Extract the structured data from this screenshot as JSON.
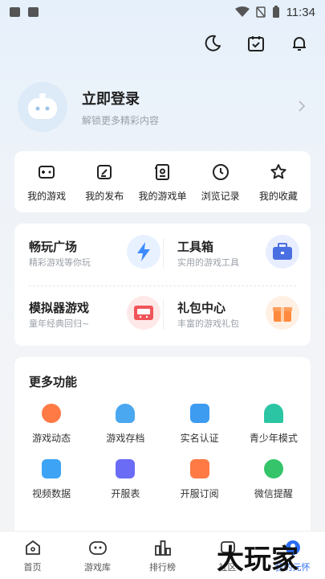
{
  "status": {
    "time": "11:34"
  },
  "profile": {
    "title": "立即登录",
    "subtitle": "解锁更多精彩内容"
  },
  "quick": [
    {
      "label": "我的游戏",
      "icon": "gamepad-icon"
    },
    {
      "label": "我的发布",
      "icon": "edit-icon"
    },
    {
      "label": "我的游戏单",
      "icon": "game-list-icon"
    },
    {
      "label": "浏览记录",
      "icon": "clock-icon"
    },
    {
      "label": "我的收藏",
      "icon": "star-icon"
    }
  ],
  "features": [
    {
      "title": "畅玩广场",
      "subtitle": "精彩游戏等你玩",
      "icon": "lightning-icon",
      "color": "#3d8bff"
    },
    {
      "title": "工具箱",
      "subtitle": "实用的游戏工具",
      "icon": "toolbox-icon",
      "color": "#4a6fe3"
    },
    {
      "title": "模拟器游戏",
      "subtitle": "童年经典回归~",
      "icon": "emulator-icon",
      "color": "#f0555a"
    },
    {
      "title": "礼包中心",
      "subtitle": "丰富的游戏礼包",
      "icon": "gift-icon",
      "color": "#ff8a3d"
    }
  ],
  "more": {
    "title": "更多功能",
    "items": [
      {
        "label": "游戏动态",
        "color": "#ff7a45"
      },
      {
        "label": "游戏存档",
        "color": "#4aa8f0"
      },
      {
        "label": "实名认证",
        "color": "#3d9bf0"
      },
      {
        "label": "青少年模式",
        "color": "#2cc5a4"
      },
      {
        "label": "视频数据",
        "color": "#3da3f5"
      },
      {
        "label": "开服表",
        "color": "#6a6cf5"
      },
      {
        "label": "开服订阅",
        "color": "#ff7a45"
      },
      {
        "label": "微信提醒",
        "color": "#35c46a"
      }
    ]
  },
  "tabs": [
    {
      "label": "首页",
      "icon": "home-icon"
    },
    {
      "label": "游戏库",
      "icon": "game-library-icon"
    },
    {
      "label": "排行榜",
      "icon": "ranking-icon"
    },
    {
      "label": "社区",
      "icon": "community-icon"
    },
    {
      "label": "我的元怀",
      "icon": "profile-icon",
      "active": true
    }
  ],
  "watermark": "大玩家"
}
